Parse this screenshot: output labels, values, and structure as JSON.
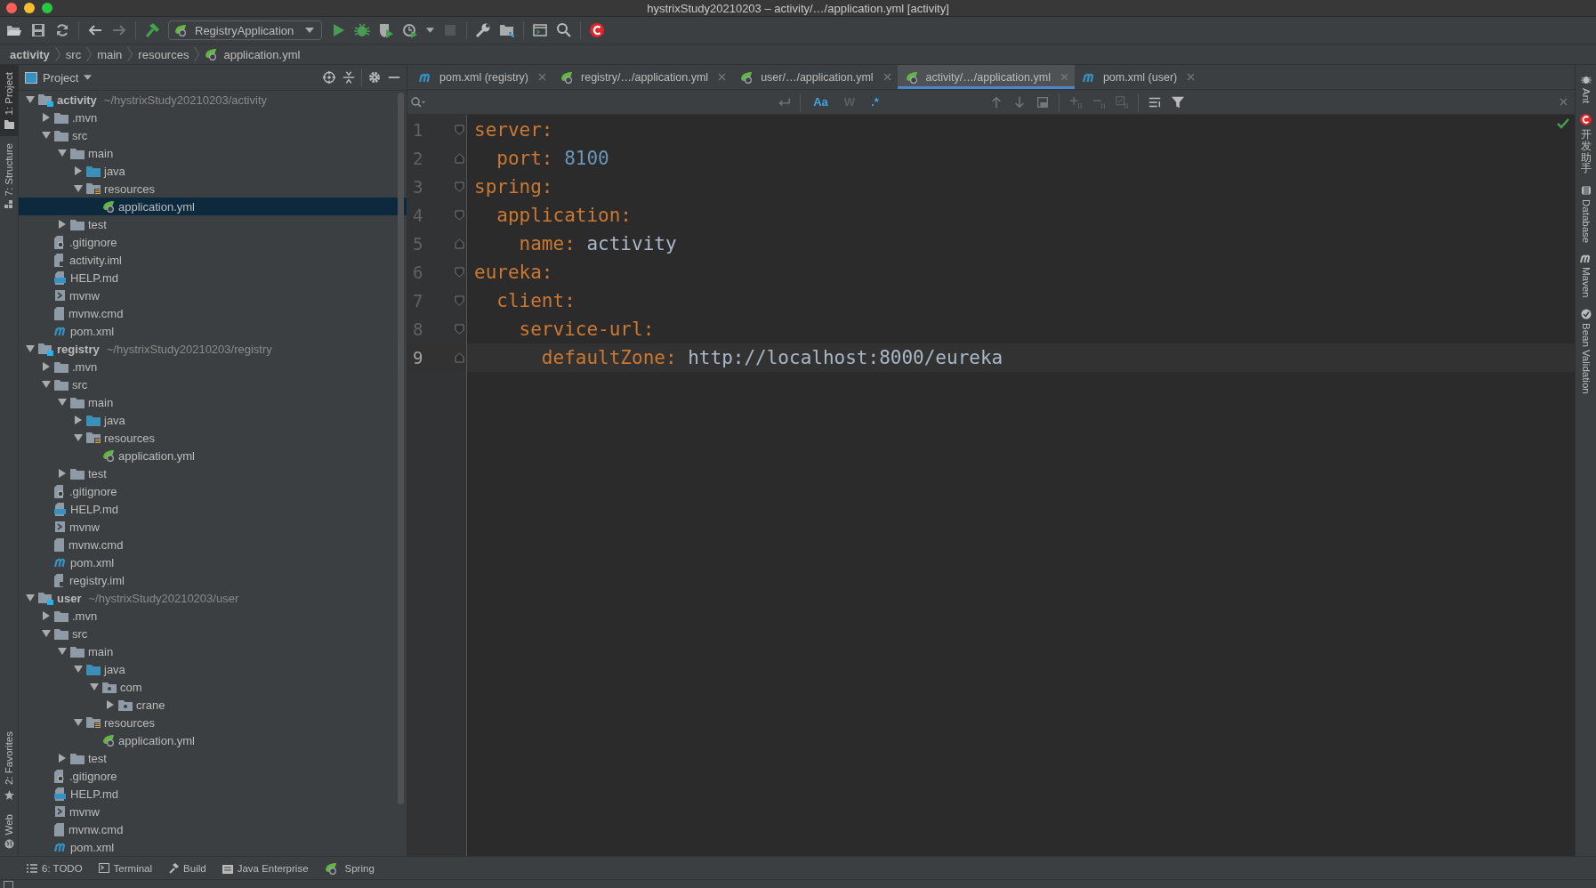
{
  "window": {
    "title": "hystrixStudy20210203 – activity/…/application.yml [activity]"
  },
  "toolbar": {
    "run_config": "RegistryApplication"
  },
  "breadcrumb": [
    {
      "label": "activity",
      "kind": "root"
    },
    {
      "label": "src",
      "kind": "folder"
    },
    {
      "label": "main",
      "kind": "folder"
    },
    {
      "label": "resources",
      "kind": "folder"
    },
    {
      "label": "application.yml",
      "kind": "yml"
    }
  ],
  "left_strip": [
    {
      "label": "1: Project",
      "selected": true,
      "kind": "project"
    },
    {
      "label": "7: Structure",
      "selected": false,
      "kind": "structure"
    }
  ],
  "left_strip_bottom": [
    {
      "label": "2: Favorites",
      "selected": false,
      "kind": "favorites"
    },
    {
      "label": "Web",
      "selected": false,
      "kind": "web"
    }
  ],
  "project_panel": {
    "title": "Project",
    "tree": [
      {
        "name": "activity",
        "path": "~/hystrixStudy20210203/activity",
        "kind": "module",
        "expanded": true,
        "selected": false,
        "children": [
          {
            "name": ".mvn",
            "kind": "folder",
            "expanded": false,
            "selected": false
          },
          {
            "name": "src",
            "kind": "folder",
            "expanded": true,
            "selected": false,
            "children": [
              {
                "name": "main",
                "kind": "folder",
                "expanded": true,
                "selected": false,
                "children": [
                  {
                    "name": "java",
                    "kind": "source",
                    "expanded": false,
                    "selected": false
                  },
                  {
                    "name": "resources",
                    "kind": "resources",
                    "expanded": true,
                    "selected": false,
                    "children": [
                      {
                        "name": "application.yml",
                        "kind": "yml",
                        "selected": true
                      }
                    ]
                  }
                ]
              },
              {
                "name": "test",
                "kind": "folder",
                "expanded": false,
                "selected": false
              }
            ]
          },
          {
            "name": ".gitignore",
            "kind": "gitignore",
            "selected": false
          },
          {
            "name": "activity.iml",
            "kind": "iml",
            "selected": false
          },
          {
            "name": "HELP.md",
            "kind": "md",
            "selected": false
          },
          {
            "name": "mvnw",
            "kind": "script",
            "selected": false
          },
          {
            "name": "mvnw.cmd",
            "kind": "cmd",
            "selected": false
          },
          {
            "name": "pom.xml",
            "kind": "pom",
            "selected": false
          }
        ]
      },
      {
        "name": "registry",
        "path": "~/hystrixStudy20210203/registry",
        "kind": "module",
        "expanded": true,
        "selected": false,
        "children": [
          {
            "name": ".mvn",
            "kind": "folder",
            "expanded": false,
            "selected": false
          },
          {
            "name": "src",
            "kind": "folder",
            "expanded": true,
            "selected": false,
            "children": [
              {
                "name": "main",
                "kind": "folder",
                "expanded": true,
                "selected": false,
                "children": [
                  {
                    "name": "java",
                    "kind": "source",
                    "expanded": false,
                    "selected": false
                  },
                  {
                    "name": "resources",
                    "kind": "resources",
                    "expanded": true,
                    "selected": false,
                    "children": [
                      {
                        "name": "application.yml",
                        "kind": "yml",
                        "selected": false
                      }
                    ]
                  }
                ]
              },
              {
                "name": "test",
                "kind": "folder",
                "expanded": false,
                "selected": false
              }
            ]
          },
          {
            "name": ".gitignore",
            "kind": "gitignore",
            "selected": false
          },
          {
            "name": "HELP.md",
            "kind": "md",
            "selected": false
          },
          {
            "name": "mvnw",
            "kind": "script",
            "selected": false
          },
          {
            "name": "mvnw.cmd",
            "kind": "cmd",
            "selected": false
          },
          {
            "name": "pom.xml",
            "kind": "pom",
            "selected": false
          },
          {
            "name": "registry.iml",
            "kind": "iml",
            "selected": false
          }
        ]
      },
      {
        "name": "user",
        "path": "~/hystrixStudy20210203/user",
        "kind": "module",
        "expanded": true,
        "selected": false,
        "children": [
          {
            "name": ".mvn",
            "kind": "folder",
            "expanded": false,
            "selected": false
          },
          {
            "name": "src",
            "kind": "folder",
            "expanded": true,
            "selected": false,
            "children": [
              {
                "name": "main",
                "kind": "folder",
                "expanded": true,
                "selected": false,
                "children": [
                  {
                    "name": "java",
                    "kind": "source",
                    "expanded": true,
                    "selected": false,
                    "children": [
                      {
                        "name": "com",
                        "kind": "package",
                        "expanded": true,
                        "selected": false,
                        "children": [
                          {
                            "name": "crane",
                            "kind": "package",
                            "expanded": false,
                            "selected": false
                          }
                        ]
                      }
                    ]
                  },
                  {
                    "name": "resources",
                    "kind": "resources",
                    "expanded": true,
                    "selected": false,
                    "children": [
                      {
                        "name": "application.yml",
                        "kind": "yml",
                        "selected": false
                      }
                    ]
                  }
                ]
              },
              {
                "name": "test",
                "kind": "folder",
                "expanded": false,
                "selected": false
              }
            ]
          },
          {
            "name": ".gitignore",
            "kind": "gitignore",
            "selected": false
          },
          {
            "name": "HELP.md",
            "kind": "md",
            "selected": false
          },
          {
            "name": "mvnw",
            "kind": "script",
            "selected": false
          },
          {
            "name": "mvnw.cmd",
            "kind": "cmd",
            "selected": false
          },
          {
            "name": "pom.xml",
            "kind": "pom",
            "selected": false
          }
        ]
      }
    ]
  },
  "tabs": [
    {
      "label": "pom.xml (registry)",
      "kind": "maven",
      "selected": false
    },
    {
      "label": "registry/…/application.yml",
      "kind": "yaml",
      "selected": false
    },
    {
      "label": "user/…/application.yml",
      "kind": "yaml",
      "selected": false
    },
    {
      "label": "activity/…/application.yml",
      "kind": "yaml",
      "selected": true
    },
    {
      "label": "pom.xml (user)",
      "kind": "maven",
      "selected": false
    }
  ],
  "search_options": [
    {
      "label": "Aa",
      "selected": true
    },
    {
      "label": "W",
      "selected": false
    },
    {
      "label": ".*",
      "selected": true
    }
  ],
  "editor": {
    "lines": [
      {
        "number": "1",
        "key": "server:",
        "kind": "mapping",
        "current": false,
        "children": [
          {
            "number": "2",
            "key": "port:",
            "value": "8100",
            "kind": "number",
            "current": false
          }
        ]
      },
      {
        "number": "3",
        "key": "spring:",
        "kind": "mapping",
        "current": false,
        "children": [
          {
            "number": "4",
            "key": "application:",
            "kind": "mapping",
            "current": false,
            "children": [
              {
                "number": "5",
                "key": "name:",
                "value": "activity",
                "kind": "string",
                "current": false
              }
            ]
          }
        ]
      },
      {
        "number": "6",
        "key": "eureka:",
        "kind": "mapping",
        "current": false,
        "children": [
          {
            "number": "7",
            "key": "client:",
            "kind": "mapping",
            "current": false,
            "children": [
              {
                "number": "8",
                "key": "service-url:",
                "kind": "mapping",
                "current": false,
                "children": [
                  {
                    "number": "9",
                    "key": "defaultZone:",
                    "value": "http://localhost:8000/eureka",
                    "kind": "string",
                    "current": true
                  }
                ]
              }
            ]
          }
        ]
      }
    ]
  },
  "right_strip": [
    {
      "label": "Ant",
      "kind": "ant"
    },
    {
      "label": "开发助手",
      "kind": "plugin"
    },
    {
      "label": "Database",
      "kind": "database"
    },
    {
      "label": "Maven",
      "kind": "maven"
    },
    {
      "label": "Bean Validation",
      "kind": "bean"
    }
  ],
  "bottom_tools": [
    {
      "label": "6: TODO",
      "kind": "todo"
    },
    {
      "label": "Terminal",
      "kind": "terminal"
    },
    {
      "label": "Build",
      "kind": "build"
    },
    {
      "label": "Java Enterprise",
      "kind": "enterprise"
    },
    {
      "label": "Spring",
      "kind": "spring"
    }
  ]
}
